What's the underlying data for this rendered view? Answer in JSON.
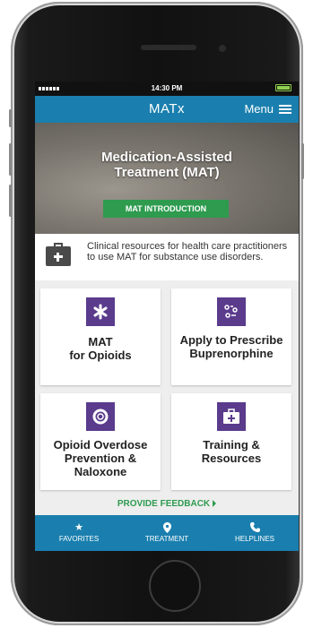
{
  "status": {
    "time": "14:30 PM",
    "battery_level": 1.0
  },
  "app": {
    "logo": "MATx",
    "menu_label": "Menu"
  },
  "hero": {
    "title": "Medication-Assisted Treatment (MAT)",
    "button": "MAT INTRODUCTION"
  },
  "intro": {
    "text": "Clinical resources for health care practitioners to use MAT for substance use disorders."
  },
  "cards": [
    {
      "label": "MAT\nfor Opioids",
      "icon": "asterisk-icon"
    },
    {
      "label": "Apply to Prescribe Buprenorphine",
      "icon": "checklist-icon"
    },
    {
      "label": "Opioid Overdose Prevention & Naloxone",
      "icon": "lifebuoy-icon"
    },
    {
      "label": "Training & Resources",
      "icon": "medical-kit-icon"
    }
  ],
  "feedback": {
    "label": "PROVIDE FEEDBACK"
  },
  "tabs": [
    {
      "label": "FAVORITES",
      "icon": "star-icon"
    },
    {
      "label": "TREATMENT",
      "icon": "location-pin-icon"
    },
    {
      "label": "HELPLINES",
      "icon": "phone-icon"
    }
  ],
  "colors": {
    "brand": "#1a7fae",
    "accent_green": "#2e9b4f",
    "card_icon": "#5a3b8c"
  }
}
